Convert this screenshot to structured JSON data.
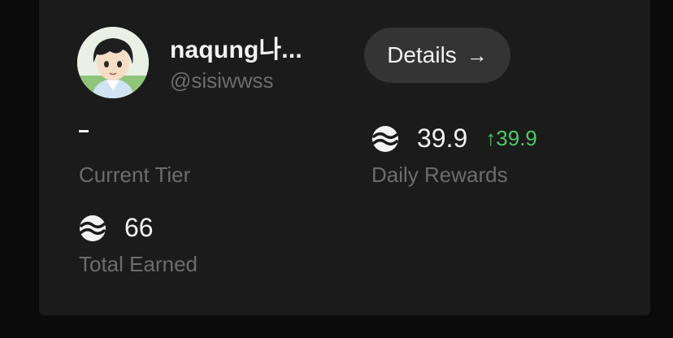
{
  "profile": {
    "username": "naqung나...",
    "handle": "@sisiwwss",
    "avatar_icon": "anime-avatar"
  },
  "details_button": {
    "label": "Details",
    "icon": "arrow-right-icon",
    "arrow": "→"
  },
  "stats": {
    "current_tier": {
      "value": "-",
      "label": "Current Tier"
    },
    "daily_rewards": {
      "value": "39.9",
      "change": "↑39.9",
      "label": "Daily Rewards",
      "icon": "token-icon"
    },
    "total_earned": {
      "value": "66",
      "label": "Total Earned",
      "icon": "token-icon"
    }
  },
  "colors": {
    "background": "#0b0b0b",
    "card": "#1b1b1b",
    "button": "#343434",
    "text_primary": "#f2f2f2",
    "text_secondary": "#6c6c6c",
    "positive": "#4ec967"
  }
}
